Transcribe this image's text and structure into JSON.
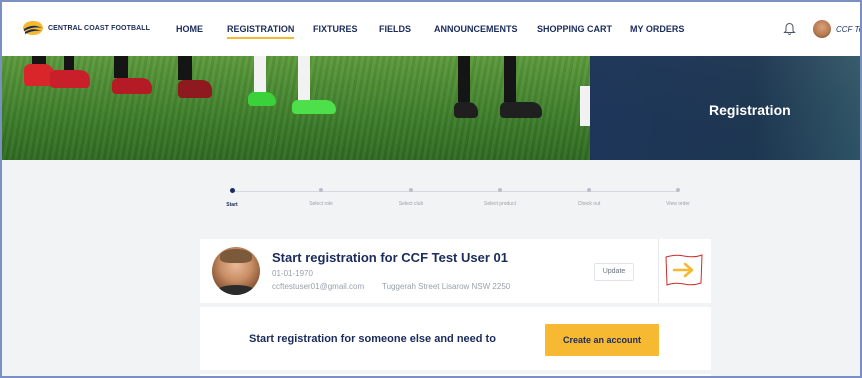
{
  "nav": {
    "logo_text": "CENTRAL COAST FOOTBALL",
    "items": [
      {
        "label": "HOME"
      },
      {
        "label": "REGISTRATION"
      },
      {
        "label": "FIXTURES"
      },
      {
        "label": "FIELDS"
      },
      {
        "label": "ANNOUNCEMENTS"
      },
      {
        "label": "SHOPPING CART"
      },
      {
        "label": "MY ORDERS"
      }
    ],
    "active_item": "REGISTRATION",
    "user_name": "CCF Tes",
    "icons": [
      "bell-icon",
      "user-avatar"
    ]
  },
  "hero": {
    "title": "Registration"
  },
  "stepper": {
    "steps": [
      {
        "label": "Start"
      },
      {
        "label": "Select role"
      },
      {
        "label": "Select club"
      },
      {
        "label": "Select product"
      },
      {
        "label": "Check out"
      },
      {
        "label": "View order"
      }
    ],
    "current": "Start"
  },
  "profile_card": {
    "title": "Start registration for CCF Test User 01",
    "dob": "01-01-1970",
    "email": "ccftestuser01@gmail.com",
    "address": "Tuggerah Street Lisarow NSW 2250",
    "update_label": "Update",
    "arrow_icon": "arrow-right-icon"
  },
  "other_card": {
    "text": "Start registration for someone else and need to",
    "button_label": "Create an account"
  },
  "colors": {
    "navy": "#1a2b5c",
    "accent_yellow": "#f6b931",
    "hero_overlay": "#1c325c"
  }
}
